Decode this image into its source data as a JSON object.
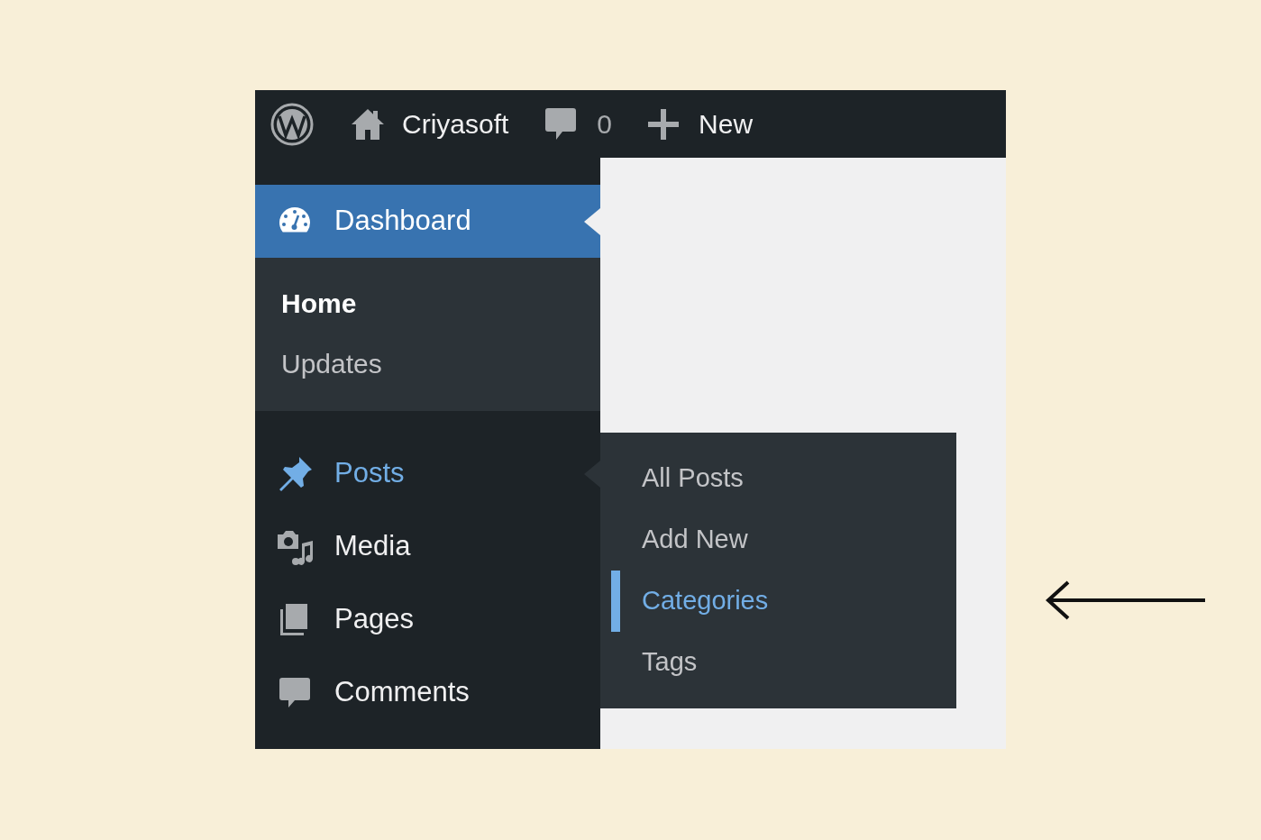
{
  "admin_bar": {
    "site_name": "Criyasoft",
    "comment_count": "0",
    "new_label": "New"
  },
  "menu": [
    {
      "label": "Dashboard",
      "kind": "dashboard",
      "selected": true,
      "highlighted": false,
      "children": [
        {
          "label": "Home",
          "selected": true
        },
        {
          "label": "Updates",
          "selected": false
        }
      ]
    },
    {
      "label": "Posts",
      "kind": "pin",
      "selected": false,
      "highlighted": true
    },
    {
      "label": "Media",
      "kind": "media",
      "selected": false,
      "highlighted": false
    },
    {
      "label": "Pages",
      "kind": "pages",
      "selected": false,
      "highlighted": false
    },
    {
      "label": "Comments",
      "kind": "comments",
      "selected": false,
      "highlighted": false
    }
  ],
  "flyout": [
    {
      "label": "All Posts",
      "selected": false
    },
    {
      "label": "Add New",
      "selected": false
    },
    {
      "label": "Categories",
      "selected": true
    },
    {
      "label": "Tags",
      "selected": false
    }
  ]
}
